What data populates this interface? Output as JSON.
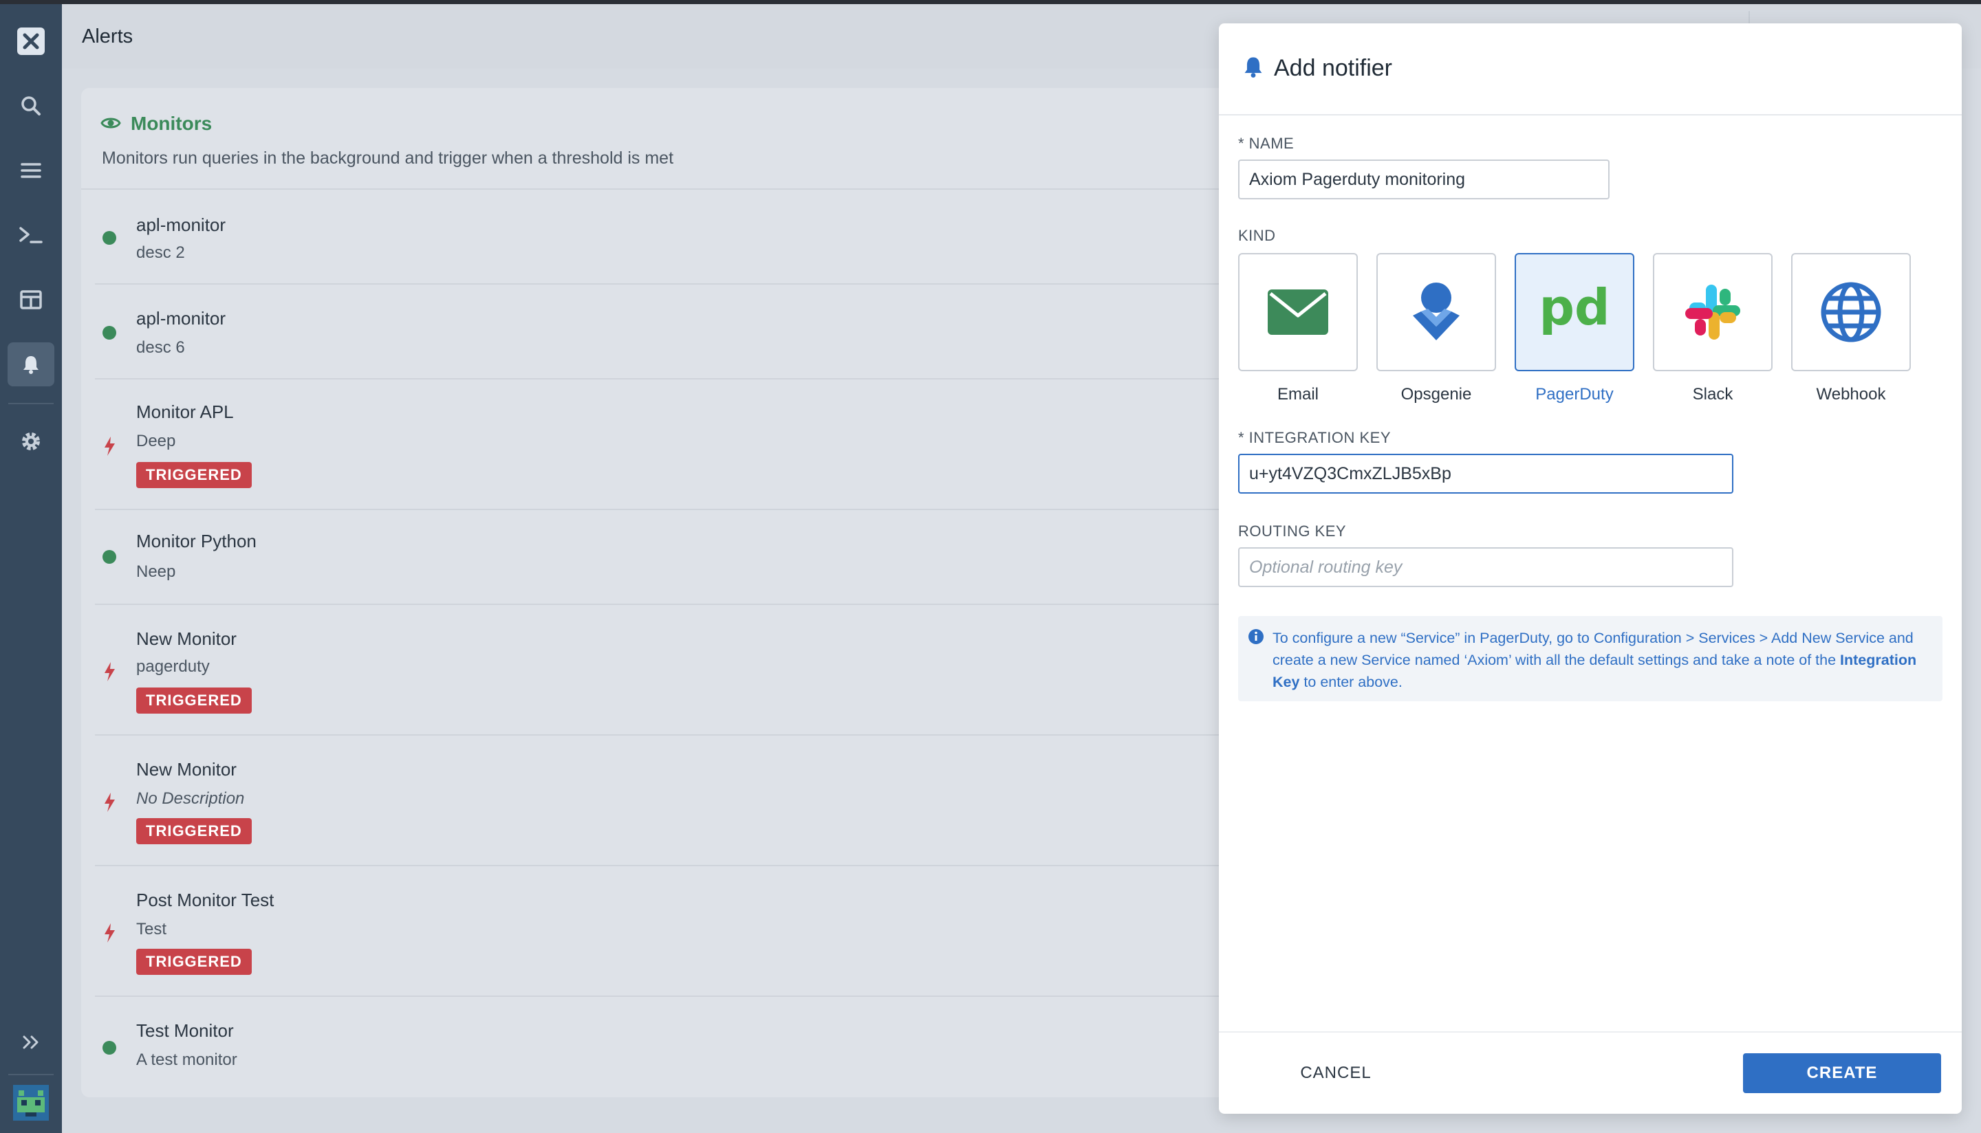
{
  "header": {
    "title": "Alerts"
  },
  "sidebar": {
    "items": [
      {
        "icon": "logo-icon"
      },
      {
        "icon": "search-icon"
      },
      {
        "icon": "stream-icon"
      },
      {
        "icon": "terminal-icon"
      },
      {
        "icon": "dashboard-icon"
      },
      {
        "icon": "bell-icon",
        "active": true
      },
      {
        "icon": "gear-icon"
      },
      {
        "icon": "expand-icon"
      },
      {
        "icon": "avatar-icon"
      }
    ]
  },
  "monitors": {
    "title": "Monitors",
    "description": "Monitors run queries in the background and trigger when a threshold is met",
    "items": [
      {
        "name": "apl-monitor",
        "desc": "desc 2",
        "status": "ok"
      },
      {
        "name": "apl-monitor",
        "desc": "desc 6",
        "status": "ok"
      },
      {
        "name": "Monitor APL",
        "desc": "Deep",
        "status": "triggered",
        "badge": "TRIGGERED"
      },
      {
        "name": "Monitor Python",
        "desc": "Neep",
        "status": "ok"
      },
      {
        "name": "New Monitor",
        "desc": "pagerduty",
        "status": "triggered",
        "badge": "TRIGGERED"
      },
      {
        "name": "New Monitor",
        "desc": "No Description",
        "status": "triggered",
        "badge": "TRIGGERED"
      },
      {
        "name": "Post Monitor Test",
        "desc": "Test",
        "status": "triggered",
        "badge": "TRIGGERED"
      },
      {
        "name": "Test Monitor",
        "desc": "A test monitor",
        "status": "ok"
      }
    ]
  },
  "panel": {
    "title": "Add notifier",
    "name_label": "* NAME",
    "name_value": "Axiom Pagerduty monitoring",
    "kind_label": "KIND",
    "kinds": [
      {
        "label": "Email",
        "icon": "email-icon"
      },
      {
        "label": "Opsgenie",
        "icon": "opsgenie-icon"
      },
      {
        "label": "PagerDuty",
        "icon": "pagerduty-icon",
        "selected": true
      },
      {
        "label": "Slack",
        "icon": "slack-icon"
      },
      {
        "label": "Webhook",
        "icon": "webhook-icon"
      }
    ],
    "integration_key_label": "* INTEGRATION KEY",
    "integration_key_value": "u+yt4VZQ3CmxZLJB5xBp",
    "routing_key_label": "ROUTING KEY",
    "routing_key_placeholder": "Optional routing key",
    "info": {
      "part1": "To configure a new “Service” in PagerDuty, go to Configuration > Services > Add New Service and create a new Service named ‘Axiom’ with all the default settings and take a note of the ",
      "bold": "Integration Key",
      "part2": " to enter above."
    },
    "cancel_label": "CANCEL",
    "create_label": "CREATE"
  },
  "colors": {
    "sidebar": "#36495d",
    "accent": "#2f6fc4",
    "ok": "#3b8a5a",
    "triggered": "#c8434a"
  }
}
